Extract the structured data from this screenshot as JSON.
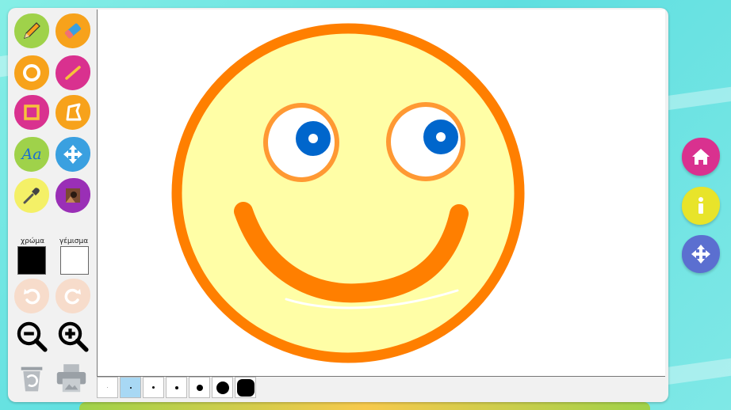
{
  "toolbar": {
    "color_label": "χρώμα",
    "fill_label": "γέμισμα",
    "stroke_color": "#000000",
    "fill_color": "#ffffff"
  },
  "tools": [
    {
      "name": "pencil-icon",
      "selected": true
    },
    {
      "name": "eraser-icon"
    },
    {
      "name": "circle-icon"
    },
    {
      "name": "line-icon"
    },
    {
      "name": "rectangle-icon"
    },
    {
      "name": "polygon-icon"
    },
    {
      "name": "text-icon"
    },
    {
      "name": "move-icon"
    },
    {
      "name": "eyedropper-icon"
    },
    {
      "name": "image-icon"
    },
    {
      "name": "undo-icon"
    },
    {
      "name": "redo-icon"
    },
    {
      "name": "zoom-out-icon"
    },
    {
      "name": "zoom-in-icon"
    },
    {
      "name": "trash-icon"
    },
    {
      "name": "print-icon"
    }
  ],
  "text_tool_glyph": "Aa",
  "brush_sizes": {
    "count": 7,
    "selected_index": 1
  },
  "side_buttons": [
    "home-icon",
    "info-icon",
    "move-icon"
  ],
  "colors": {
    "face_fill": "#fffea6",
    "face_stroke": "#ff7f00",
    "eye_ring": "#ff9933",
    "pupil": "#0066cc"
  }
}
